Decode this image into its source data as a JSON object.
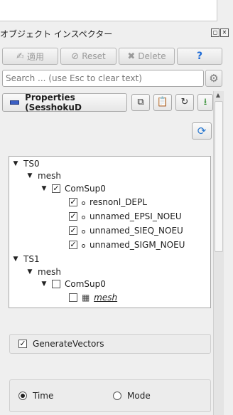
{
  "panel": {
    "title": "オブジェクト インスペクター",
    "float_icon": "float-icon",
    "close_icon": "close-icon"
  },
  "toolbar": {
    "apply_label": "適用",
    "reset_label": "Reset",
    "delete_label": "Delete",
    "help_label": "?"
  },
  "search": {
    "placeholder": "Search ... (use Esc to clear text)"
  },
  "properties": {
    "label": "Properties (SesshokuD"
  },
  "tree": {
    "items": [
      {
        "label": "TS0"
      },
      {
        "label": "mesh"
      },
      {
        "label": "ComSup0",
        "checked": true
      },
      {
        "label": "resnonl_DEPL",
        "checked": true
      },
      {
        "label": "unnamed_EPSI_NOEU",
        "checked": true
      },
      {
        "label": "unnamed_SIEQ_NOEU",
        "checked": true
      },
      {
        "label": "unnamed_SIGM_NOEU",
        "checked": true
      },
      {
        "label": "TS1"
      },
      {
        "label": "mesh"
      },
      {
        "label": "ComSup0",
        "checked": false
      },
      {
        "label": "mesh",
        "checked": false
      }
    ]
  },
  "options": {
    "generate_vectors_label": "GenerateVectors",
    "generate_vectors_checked": true,
    "time_label": "Time",
    "mode_label": "Mode",
    "selected": "Time"
  },
  "colors": {
    "accent": "#1c6ad6",
    "properties_bar": "#3b5fc4"
  }
}
